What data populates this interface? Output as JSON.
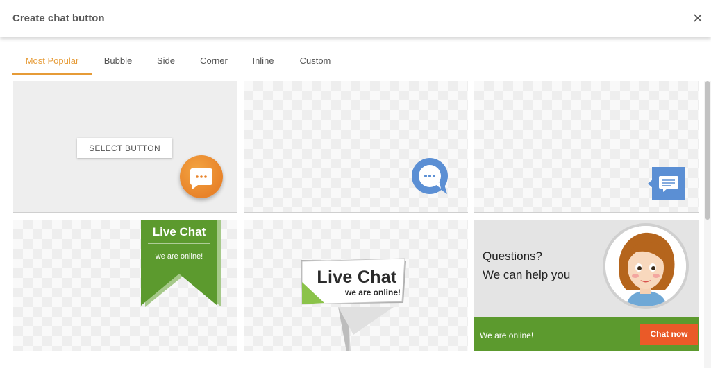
{
  "dialog": {
    "title": "Create chat button",
    "close_icon": "close-icon"
  },
  "tabs": [
    {
      "label": "Most Popular",
      "active": true
    },
    {
      "label": "Bubble",
      "active": false
    },
    {
      "label": "Side",
      "active": false
    },
    {
      "label": "Corner",
      "active": false
    },
    {
      "label": "Inline",
      "active": false
    },
    {
      "label": "Custom",
      "active": false
    }
  ],
  "tiles": {
    "select_button_label": "SELECT BUTTON",
    "ribbon": {
      "title": "Live Chat",
      "subtitle": "we are online!"
    },
    "sign": {
      "title": "Live Chat",
      "subtitle": "we are online!"
    },
    "card": {
      "line1": "Questions?",
      "line2": "We can help you",
      "online": "We are online!",
      "button": "Chat now"
    }
  },
  "colors": {
    "accent": "#e69b37",
    "orange_button": "#e8832a",
    "blue_button": "#5b8fd4",
    "green": "#5c9a2e",
    "chat_now": "#ea5a28"
  }
}
